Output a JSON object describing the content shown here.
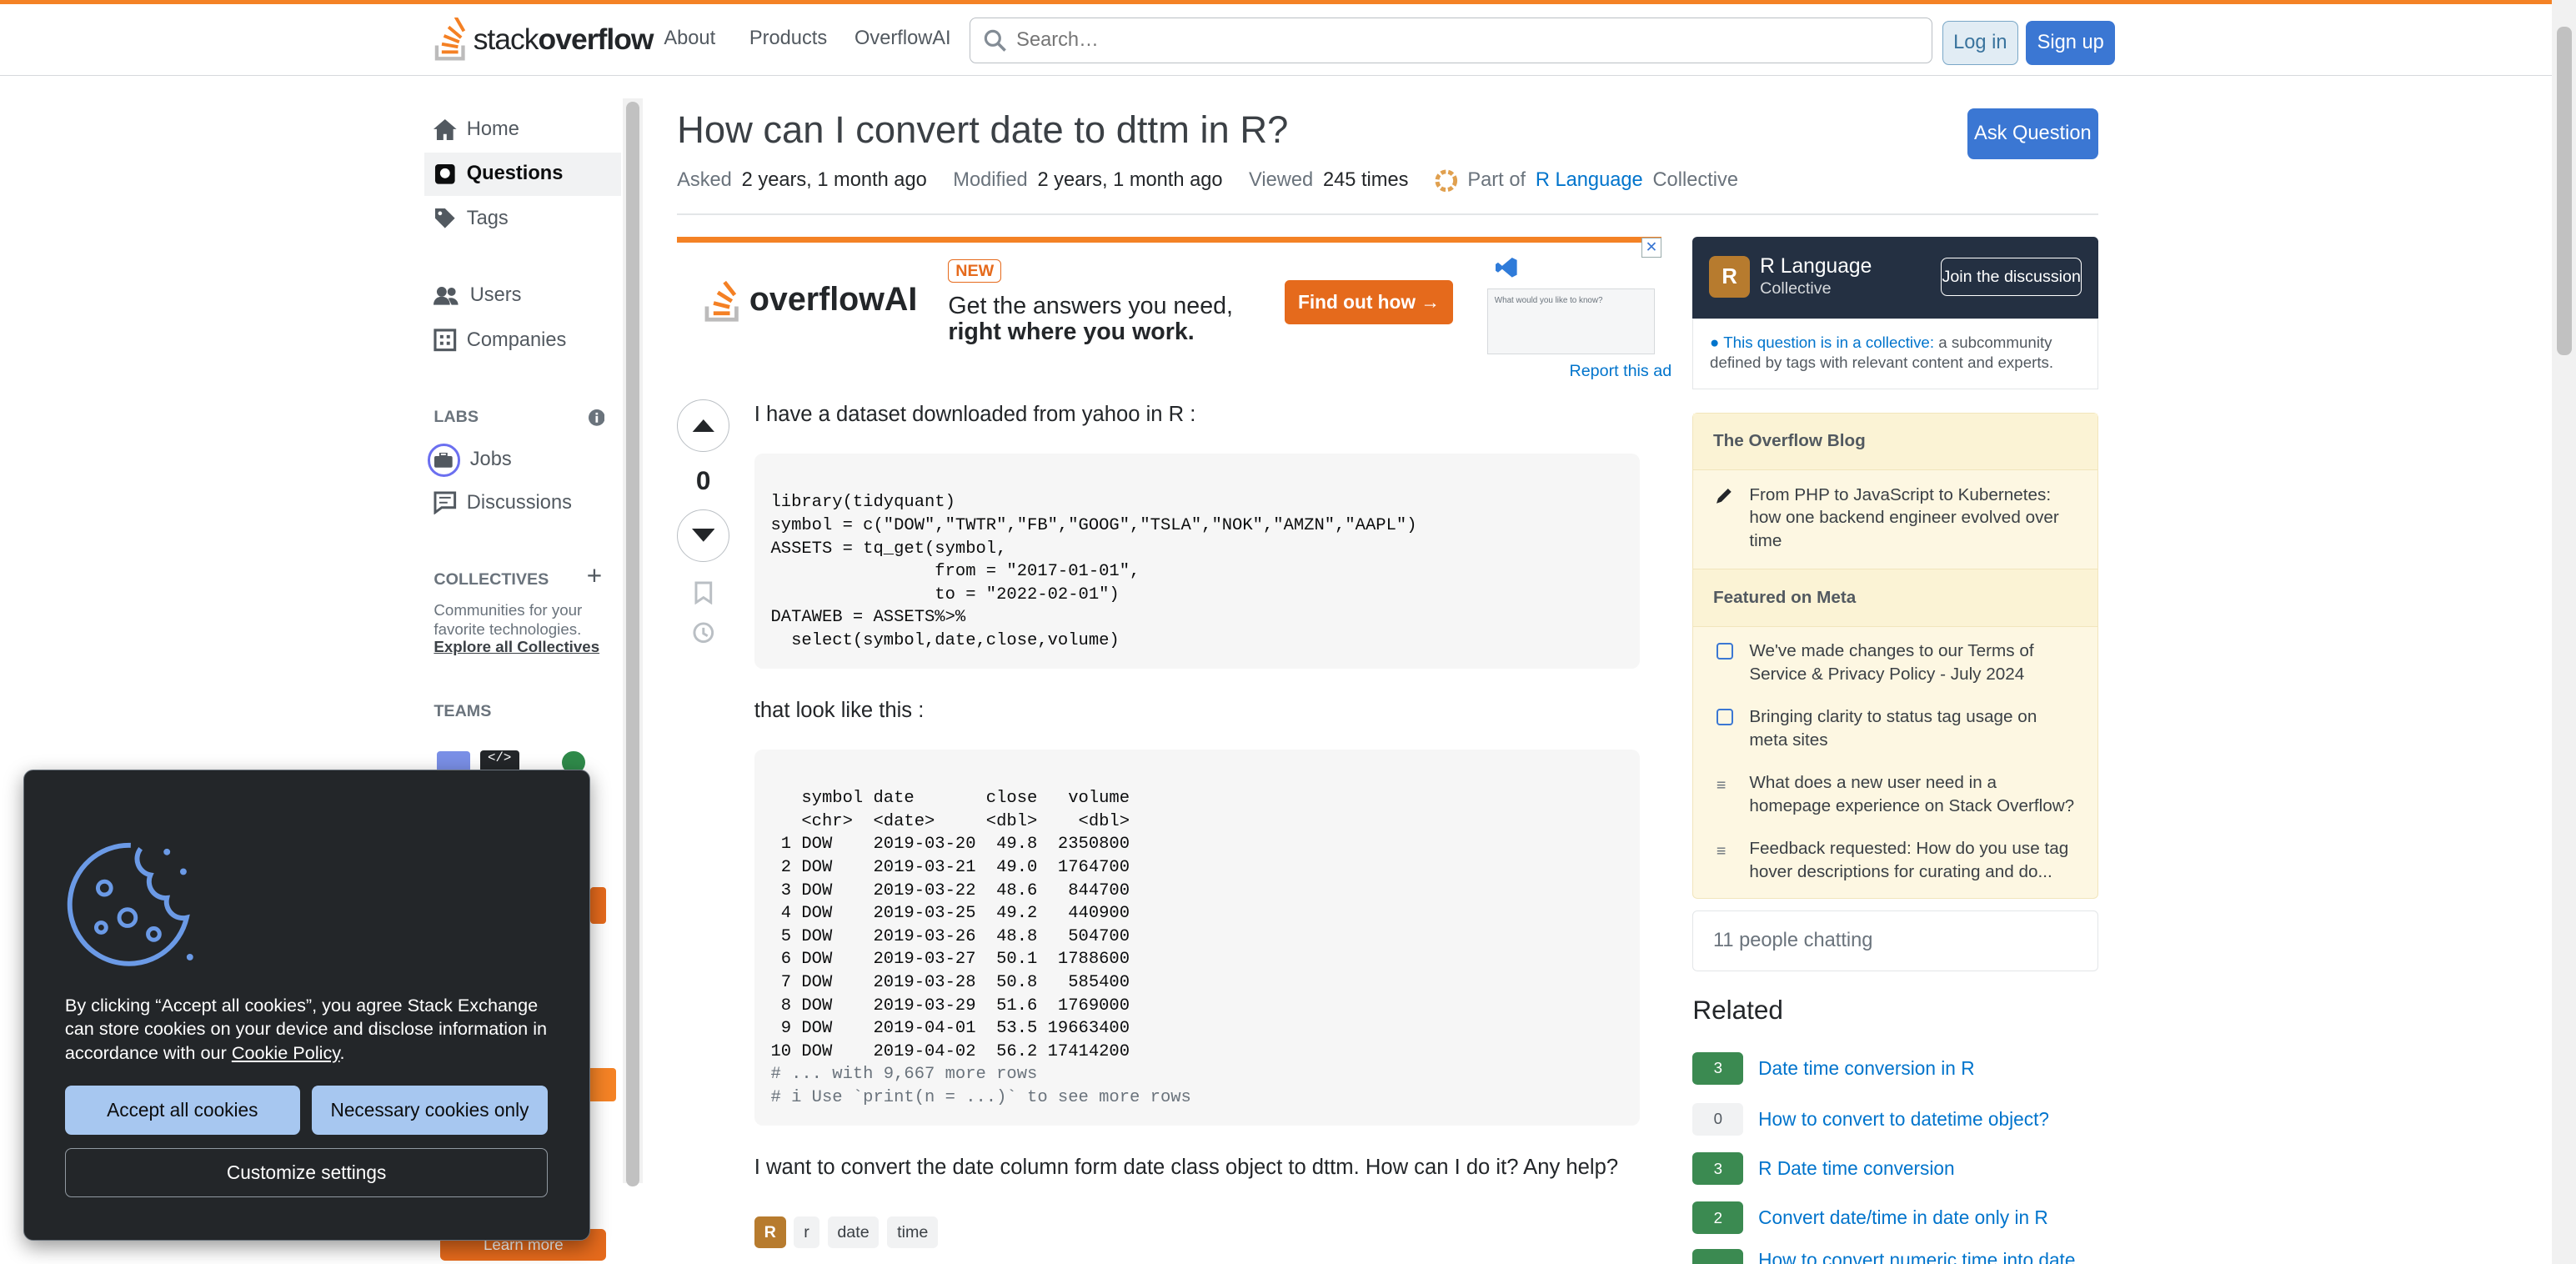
{
  "header": {
    "logo_prefix": "stack",
    "logo_suffix": "overflow",
    "nav": [
      "About",
      "Products",
      "OverflowAI"
    ],
    "search_placeholder": "Search…",
    "login": "Log in",
    "signup": "Sign up"
  },
  "sidebar": {
    "home": "Home",
    "questions": "Questions",
    "tags": "Tags",
    "users": "Users",
    "companies": "Companies",
    "labs": "LABS",
    "jobs": "Jobs",
    "discussions": "Discussions",
    "collectives": "COLLECTIVES",
    "collectives_desc": "Communities for your favorite technologies.",
    "explore": "Explore all Collectives",
    "teams": "TEAMS",
    "learn_more": "Learn more"
  },
  "question": {
    "title": "How can I convert date to dttm in R?",
    "ask_button": "Ask Question",
    "asked_label": "Asked",
    "asked": "2 years, 1 month ago",
    "modified_label": "Modified",
    "modified": "2 years, 1 month ago",
    "viewed_label": "Viewed",
    "viewed": "245 times",
    "part_of": "Part of",
    "collective_name": "R Language",
    "collective_suffix": "Collective",
    "votes": "0",
    "body_1": "I have a dataset downloaded from yahoo in R :",
    "body_2": "that look like this :",
    "body_3": "I want to convert the date column form date class object to dttm. How can I do it? Any help?",
    "tags": [
      "R",
      "r",
      "date",
      "time"
    ]
  },
  "ad": {
    "badge": "NEW",
    "brand": "overflowAI",
    "line1": "Get the answers you need,",
    "line2": "right where you work.",
    "cta": "Find out how →",
    "report": "Report this ad",
    "prompt": "What would you like to know?"
  },
  "code1": [
    "library(tidyquant)",
    "symbol = c(\"DOW\",\"TWTR\",\"FB\",\"GOOG\",\"TSLA\",\"NOK\",\"AMZN\",\"AAPL\")",
    "ASSETS = tq_get(symbol,",
    "                from = \"2017-01-01\",",
    "                to = \"2022-02-01\")",
    "DATAWEB = ASSETS%>%",
    "  select(symbol,date,close,volume)"
  ],
  "code2": [
    "   symbol date       close   volume",
    "   <chr>  <date>     <dbl>    <dbl>",
    " 1 DOW    2019-03-20  49.8  2350800",
    " 2 DOW    2019-03-21  49.0  1764700",
    " 3 DOW    2019-03-22  48.6   844700",
    " 4 DOW    2019-03-25  49.2   440900",
    " 5 DOW    2019-03-26  48.8   504700",
    " 6 DOW    2019-03-27  50.1  1788600",
    " 7 DOW    2019-03-28  50.8   585400",
    " 8 DOW    2019-03-29  51.6  1769000",
    " 9 DOW    2019-04-01  53.5 19663400",
    "10 DOW    2019-04-02  56.2 17414200",
    "# ... with 9,667 more rows",
    "# i Use `print(n = ...)` to see more rows"
  ],
  "right": {
    "collective_title": "R Language",
    "collective_sub": "Collective",
    "join": "Join the discussion",
    "in_collective": "This question is in a collective:",
    "in_collective_desc": "a subcommunity defined by tags with relevant content and experts.",
    "blog_title": "The Overflow Blog",
    "blog_items": [
      "From PHP to JavaScript to Kubernetes: how one backend engineer evolved over time"
    ],
    "meta_title": "Featured on Meta",
    "meta_items": [
      "We've made changes to our Terms of Service & Privacy Policy - July 2024",
      "Bringing clarity to status tag usage on meta sites",
      "What does a new user need in a homepage experience on Stack Overflow?",
      "Feedback requested: How do you use tag hover descriptions for curating and do..."
    ],
    "chat": "11 people chatting",
    "related_title": "Related",
    "related": [
      {
        "count": "3",
        "title": "Date time conversion in R"
      },
      {
        "count": "0",
        "title": "How to convert to datetime object?"
      },
      {
        "count": "3",
        "title": "R Date time conversion"
      },
      {
        "count": "2",
        "title": "Convert date/time in date only in R"
      },
      {
        "count": "",
        "title": "How to convert numeric time into date"
      }
    ]
  },
  "cookie": {
    "text_a": "By clicking “Accept all cookies”, you agree Stack Exchange can store cookies on your device and disclose information in accordance with our ",
    "policy": "Cookie Policy",
    "text_b": ".",
    "accept": "Accept all cookies",
    "necessary": "Necessary cookies only",
    "customize": "Customize settings"
  }
}
